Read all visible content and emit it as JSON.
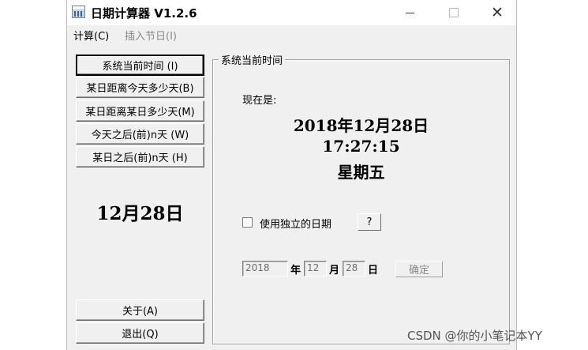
{
  "window": {
    "title": "日期计算器  V1.2.6",
    "close_glyph": "✕"
  },
  "menu": {
    "calc": "计算(C)",
    "insert_holiday": "插入节日(I)"
  },
  "left_buttons": [
    {
      "label": "系统当前时间   (I)"
    },
    {
      "label": "某日距离今天多少天(B)"
    },
    {
      "label": "某日距离某日多少天(M)"
    },
    {
      "label": "今天之后(前)n天  (W)"
    },
    {
      "label": "某日之后(前)n天  (H)"
    }
  ],
  "today_short": "12月28日",
  "bottom_buttons": {
    "about": "关于(A)",
    "exit": "退出(Q)"
  },
  "panel": {
    "title": "系统当前时间",
    "now_label": "现在是:",
    "date": "2018年12月28日",
    "time": "17:27:15",
    "weekday": "星期五",
    "independent_date_label": "使用独立的日期",
    "help_label": "?",
    "year_value": "2018",
    "year_unit": "年",
    "month_value": "12",
    "month_unit": "月",
    "day_value": "28",
    "day_unit": "日",
    "ok_label": "确定"
  },
  "watermark": "CSDN @你的小笔记本YY",
  "icons": {
    "app": "calendar-app-icon",
    "minimize": "minimize-icon",
    "maximize": "maximize-icon",
    "close": "close-icon"
  }
}
